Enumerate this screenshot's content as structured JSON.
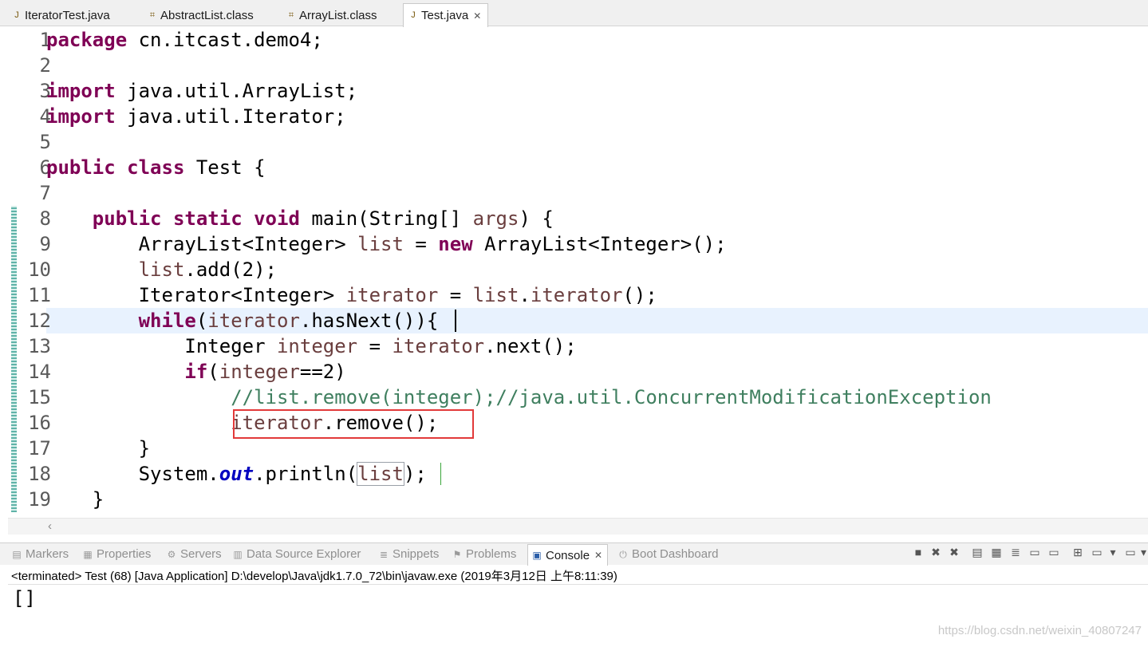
{
  "editor_tabs": [
    {
      "label": "IteratorTest.java",
      "icon": "java-file-icon"
    },
    {
      "label": "AbstractList.class",
      "icon": "class-file-icon"
    },
    {
      "label": "ArrayList.class",
      "icon": "class-file-icon"
    },
    {
      "label": "Test.java",
      "icon": "java-file-icon",
      "active": true
    }
  ],
  "editor": {
    "line_numbers": [
      "1",
      "2",
      "3",
      "4",
      "5",
      "6",
      "7",
      "8",
      "9",
      "10",
      "11",
      "12",
      "13",
      "14",
      "15",
      "16",
      "17",
      "18",
      "19"
    ],
    "lines": [
      "package cn.itcast.demo4;",
      "",
      "import java.util.ArrayList;",
      "import java.util.Iterator;",
      "",
      "public class Test {",
      "",
      "    public static void main(String[] args) {",
      "        ArrayList<Integer> list = new ArrayList<Integer>();",
      "        list.add(2);",
      "        Iterator<Integer> iterator = list.iterator();",
      "        while(iterator.hasNext()){",
      "            Integer integer = iterator.next();",
      "            if(integer==2)",
      "                //list.remove(integer);//java.util.ConcurrentModificationException",
      "                iterator.remove();",
      "        }",
      "        System.out.println(list);",
      "    }"
    ],
    "current_line": 12,
    "highlighted_line": 16
  },
  "views": {
    "tabs": [
      {
        "label": "Markers",
        "icon": "markers-icon"
      },
      {
        "label": "Properties",
        "icon": "properties-icon"
      },
      {
        "label": "Servers",
        "icon": "servers-icon"
      },
      {
        "label": "Data Source Explorer",
        "icon": "data-source-icon"
      },
      {
        "label": "Snippets",
        "icon": "snippets-icon"
      },
      {
        "label": "Problems",
        "icon": "problems-icon"
      },
      {
        "label": "Console",
        "icon": "console-icon",
        "active": true
      },
      {
        "label": "Boot Dashboard",
        "icon": "boot-dashboard-icon"
      }
    ]
  },
  "console": {
    "status": "<terminated> Test (68) [Java Application] D:\\develop\\Java\\jdk1.7.0_72\\bin\\javaw.exe (2019年3月12日 上午8:11:39)",
    "output": "[]"
  },
  "watermark": "https://blog.csdn.net/weixin_40807247",
  "colors": {
    "keyword": "#7f0055",
    "field": "#6a3e3e",
    "comment": "#3f7f5f",
    "static": "#0000c0",
    "annotation_box": "#e23a3a"
  }
}
